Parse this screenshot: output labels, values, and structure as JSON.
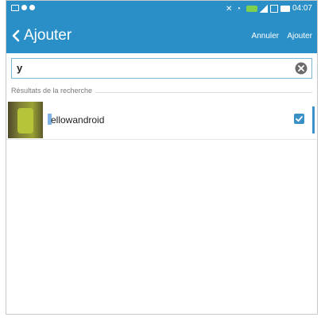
{
  "action_bar": {
    "title": "Ajouter",
    "cancel_label": "Annuler",
    "add_label": "Ajouter"
  },
  "status_bar": {
    "time": "04:07"
  },
  "search": {
    "value": "y"
  },
  "results": {
    "header": "Résultats de la recherche",
    "items": [
      {
        "name_suffix": "ellowandroid",
        "checked": true
      }
    ]
  },
  "colors": {
    "accent": "#2a8fc7",
    "checkbox": "#3a91c8"
  },
  "icons": {
    "back": "chevron-left-icon",
    "clear": "clear-circle-icon",
    "check": "checkmark-icon"
  }
}
